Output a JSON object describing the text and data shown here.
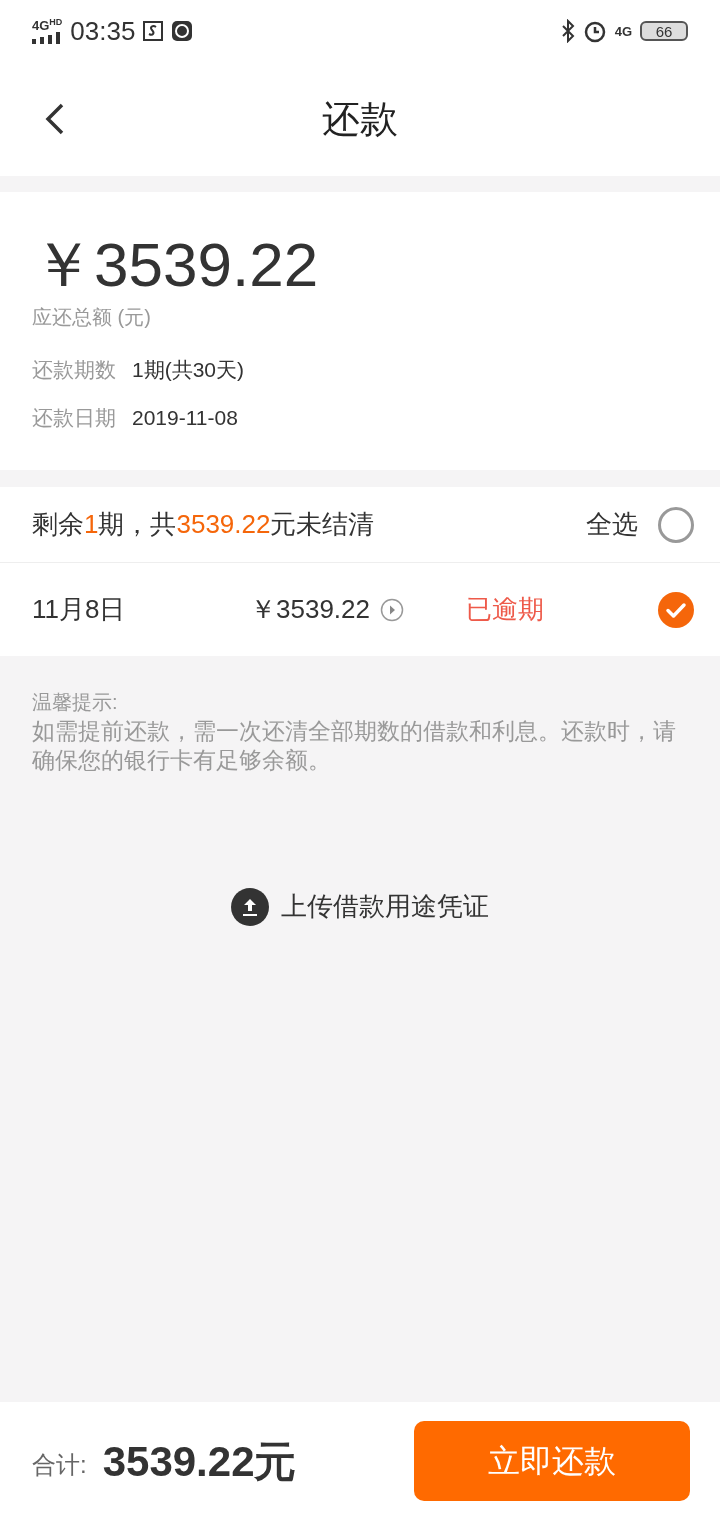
{
  "status_bar": {
    "network": "4G",
    "network_sup": "HD",
    "time": "03:35",
    "data_type": "4G",
    "battery": "66"
  },
  "header": {
    "title": "还款"
  },
  "summary_card": {
    "amount": "￥3539.22",
    "amount_label": "应还总额 (元)",
    "details": [
      {
        "label": "还款期数",
        "value": "1期(共30天)"
      },
      {
        "label": "还款日期",
        "value": "2019-11-08"
      }
    ]
  },
  "installments": {
    "summary": [
      {
        "text": "剩余",
        "highlight": false
      },
      {
        "text": "1",
        "highlight": true
      },
      {
        "text": "期，共",
        "highlight": false
      },
      {
        "text": "3539.22",
        "highlight": true
      },
      {
        "text": "元未结清",
        "highlight": false
      }
    ],
    "select_all": {
      "label": "全选",
      "checked": false
    },
    "rows": [
      {
        "date": "11月8日",
        "amount": "￥3539.22",
        "status": "已逾期",
        "checked": true
      }
    ]
  },
  "tips": {
    "title": "温馨提示:",
    "body": "如需提前还款，需一次还清全部期数的借款和利息。还款时，请确保您的银行卡有足够余额。"
  },
  "upload": {
    "label": "上传借款用途凭证"
  },
  "footer": {
    "total_label": "合计:",
    "total": "3539.22元",
    "button": "立即还款"
  }
}
